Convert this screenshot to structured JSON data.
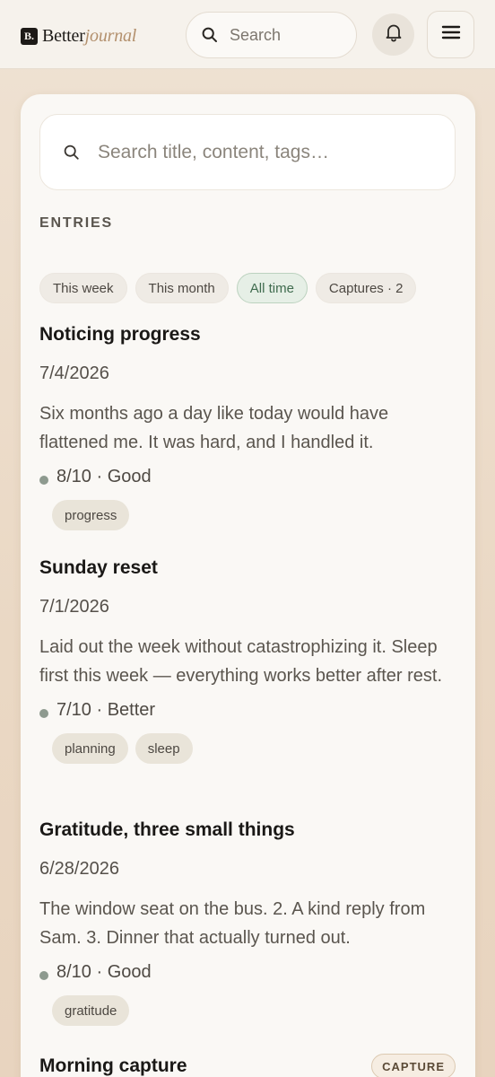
{
  "header": {
    "logo_badge": "B.",
    "logo_word_a": "Better",
    "logo_word_b": "journal",
    "search_placeholder": "Search"
  },
  "entry_search": {
    "placeholder": "Search title, content, tags…"
  },
  "section_label": "ENTRIES",
  "filters": [
    {
      "label": "This week",
      "active": false
    },
    {
      "label": "This month",
      "active": false
    },
    {
      "label": "All time",
      "active": true
    },
    {
      "label": "Captures · 2",
      "active": false
    }
  ],
  "entries": [
    {
      "title": "Noticing progress",
      "date": "7/4/2026",
      "body": "Six months ago a day like today would have flattened me. It was hard, and I handled it.",
      "mood": "8/10 · Good",
      "tags": [
        "progress"
      ]
    },
    {
      "title": "Sunday reset",
      "date": "7/1/2026",
      "body": "Laid out the week without catastrophizing it. Sleep first this week — everything works better after rest.",
      "mood": "7/10 · Better",
      "tags": [
        "planning",
        "sleep"
      ]
    },
    {
      "title": "Gratitude, three small things",
      "date": "6/28/2026",
      "body": "The window seat on the bus. 2. A kind reply from Sam. 3. Dinner that actually turned out.",
      "mood": "8/10 · Good",
      "tags": [
        "gratitude"
      ]
    },
    {
      "title": "Morning capture",
      "badge": "CAPTURE"
    }
  ],
  "colors": {
    "accent_green": "#3f6b4e",
    "mood_dot": "#8e9a8f",
    "logo_accent": "#b3906d"
  },
  "icons": {
    "search": "search-icon",
    "bell": "bell-icon",
    "menu": "menu-icon"
  }
}
